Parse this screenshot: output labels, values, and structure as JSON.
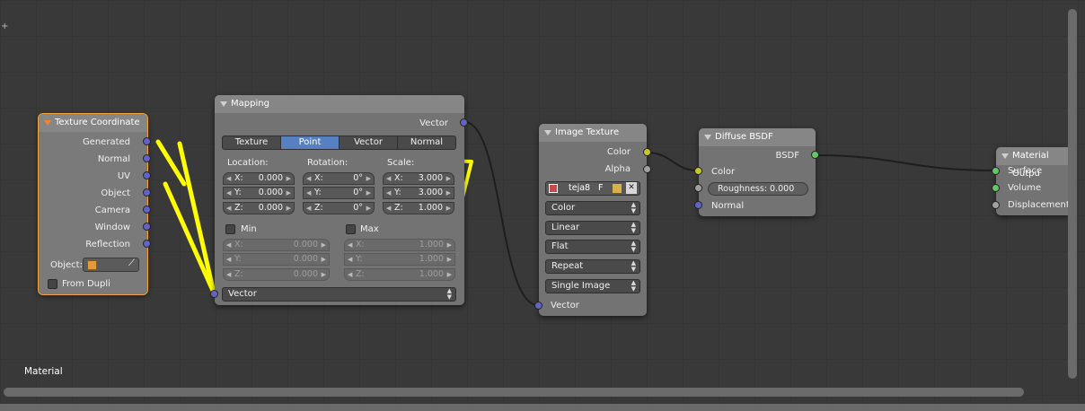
{
  "editor": {
    "material_label": "Material",
    "plus_glyph": "+"
  },
  "colors": {
    "vector_socket": "#6363c7",
    "color_socket": "#c7c729",
    "shader_socket": "#63c763",
    "gray_socket": "#a1a1a1",
    "highlight": "#ffff00",
    "selected_tab": "#5680c2",
    "active_outline": "#f2a33a"
  },
  "tex_coord": {
    "title": "Texture Coordinate",
    "outputs": [
      "Generated",
      "Normal",
      "UV",
      "Object",
      "Camera",
      "Window",
      "Reflection"
    ],
    "object_label": "Object:",
    "from_dupli": "From Dupli"
  },
  "mapping": {
    "title": "Mapping",
    "output": "Vector",
    "tabs": [
      "Texture",
      "Point",
      "Vector",
      "Normal"
    ],
    "selected_tab": "Point",
    "location_label": "Location:",
    "rotation_label": "Rotation:",
    "scale_label": "Scale:",
    "location": [
      {
        "k": "X:",
        "v": "0.000"
      },
      {
        "k": "Y:",
        "v": "0.000"
      },
      {
        "k": "Z:",
        "v": "0.000"
      }
    ],
    "rotation": [
      {
        "k": "X:",
        "v": "0°"
      },
      {
        "k": "Y:",
        "v": "0°"
      },
      {
        "k": "Z:",
        "v": "0°"
      }
    ],
    "scale": [
      {
        "k": "X:",
        "v": "3.000"
      },
      {
        "k": "Y:",
        "v": "3.000"
      },
      {
        "k": "Z:",
        "v": "1.000"
      }
    ],
    "min_label": "Min",
    "max_label": "Max",
    "min": [
      {
        "k": "X:",
        "v": "0.000"
      },
      {
        "k": "Y:",
        "v": "0.000"
      },
      {
        "k": "Z:",
        "v": "0.000"
      }
    ],
    "max": [
      {
        "k": "X:",
        "v": "1.000"
      },
      {
        "k": "Y:",
        "v": "1.000"
      },
      {
        "k": "Z:",
        "v": "1.000"
      }
    ],
    "vector_input": "Vector"
  },
  "image_texture": {
    "title": "Image Texture",
    "outputs": [
      "Color",
      "Alpha"
    ],
    "image_name": "teja8",
    "fake_user": "F",
    "menus": [
      "Color",
      "Linear",
      "Flat",
      "Repeat",
      "Single Image"
    ],
    "input": "Vector"
  },
  "diffuse": {
    "title": "Diffuse BSDF",
    "output": "BSDF",
    "color_input": "Color",
    "roughness": "Roughness: 0.000",
    "normal_input": "Normal"
  },
  "material_output": {
    "title": "Material Outpu",
    "inputs": [
      "Surface",
      "Volume",
      "Displacement"
    ]
  }
}
